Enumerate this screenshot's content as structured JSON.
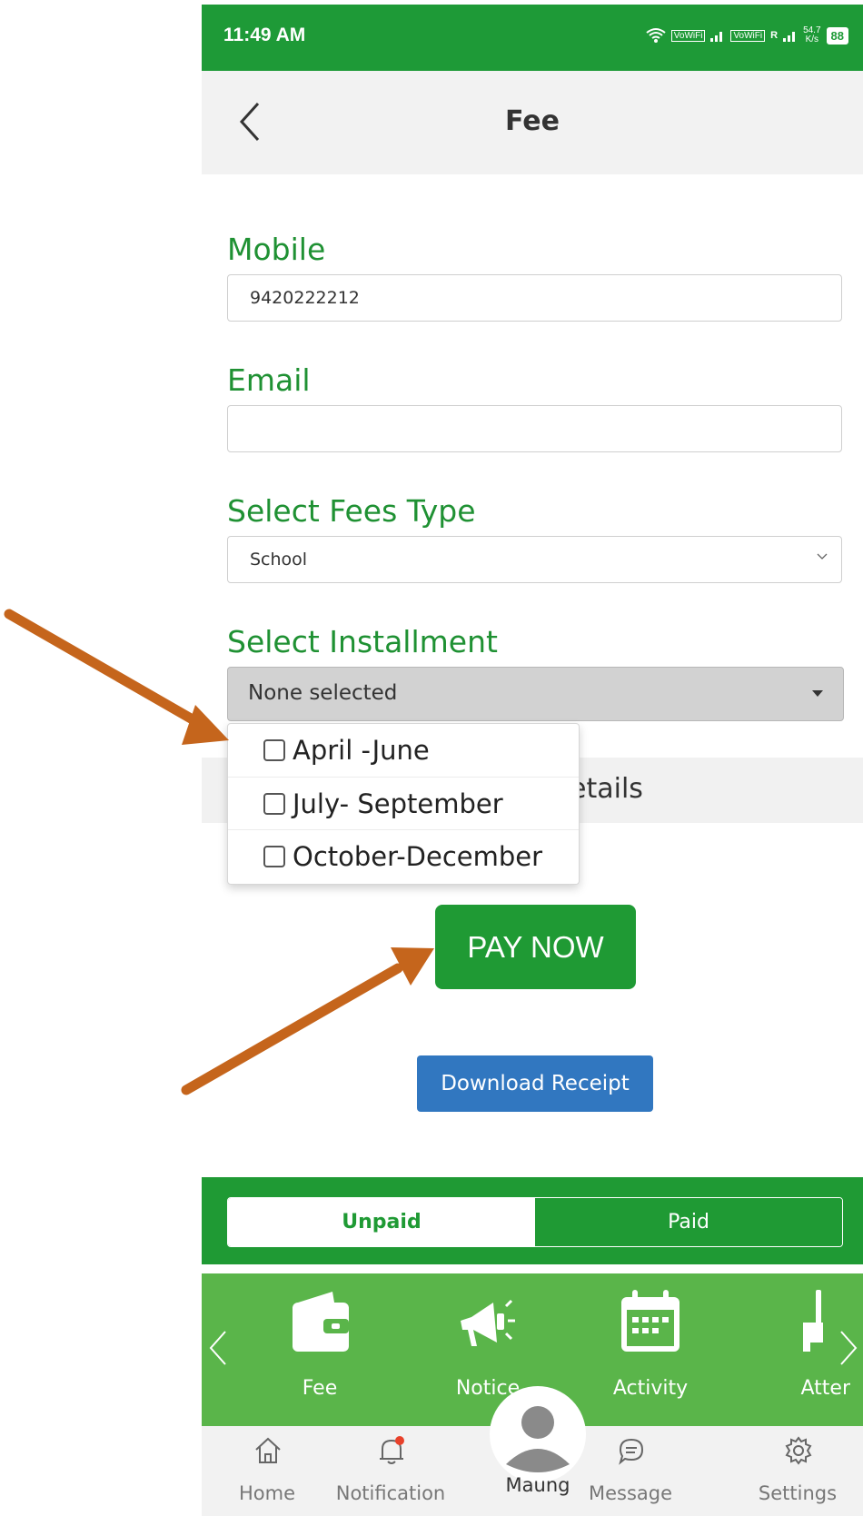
{
  "status_bar": {
    "time": "11:49 AM",
    "net1": "VoWiFi",
    "net2": "VoWiFi",
    "roaming": "R",
    "speed_value": "54.7",
    "speed_unit": "K/s",
    "battery": "88"
  },
  "header": {
    "title": "Fee",
    "back_icon": "chevron-left-icon"
  },
  "form": {
    "mobile_label": "Mobile",
    "mobile_value": "9420222212",
    "email_label": "Email",
    "email_value": "",
    "fees_type_label": "Select Fees Type",
    "fees_type_value": "School",
    "installment_label": "Select Installment",
    "installment_value": "None selected",
    "installment_options": [
      "April -June",
      "July- September",
      "October-December"
    ],
    "details_text": "etails"
  },
  "buttons": {
    "pay_now": "PAY NOW",
    "download_receipt": "Download Receipt"
  },
  "tabs": {
    "unpaid": "Unpaid",
    "paid": "Paid"
  },
  "carousel": {
    "items": [
      {
        "label": "Fee",
        "icon": "wallet-icon"
      },
      {
        "label": "Notice",
        "icon": "megaphone-icon"
      },
      {
        "label": "Activity",
        "icon": "calendar-icon"
      },
      {
        "label": "Atter",
        "icon": "attendance-icon"
      }
    ]
  },
  "bottom_nav": {
    "items": [
      {
        "label": "Home",
        "icon": "home-icon"
      },
      {
        "label": "Notification",
        "icon": "bell-icon"
      },
      {
        "label": "Maung",
        "icon": "avatar-icon"
      },
      {
        "label": "Message",
        "icon": "chat-icon"
      },
      {
        "label": "Settings",
        "icon": "gear-icon"
      }
    ]
  },
  "colors": {
    "primary_green": "#1f9a34",
    "carousel_green": "#5ab54a",
    "download_blue": "#3177c0",
    "annotation_arrow": "#c5651c"
  }
}
